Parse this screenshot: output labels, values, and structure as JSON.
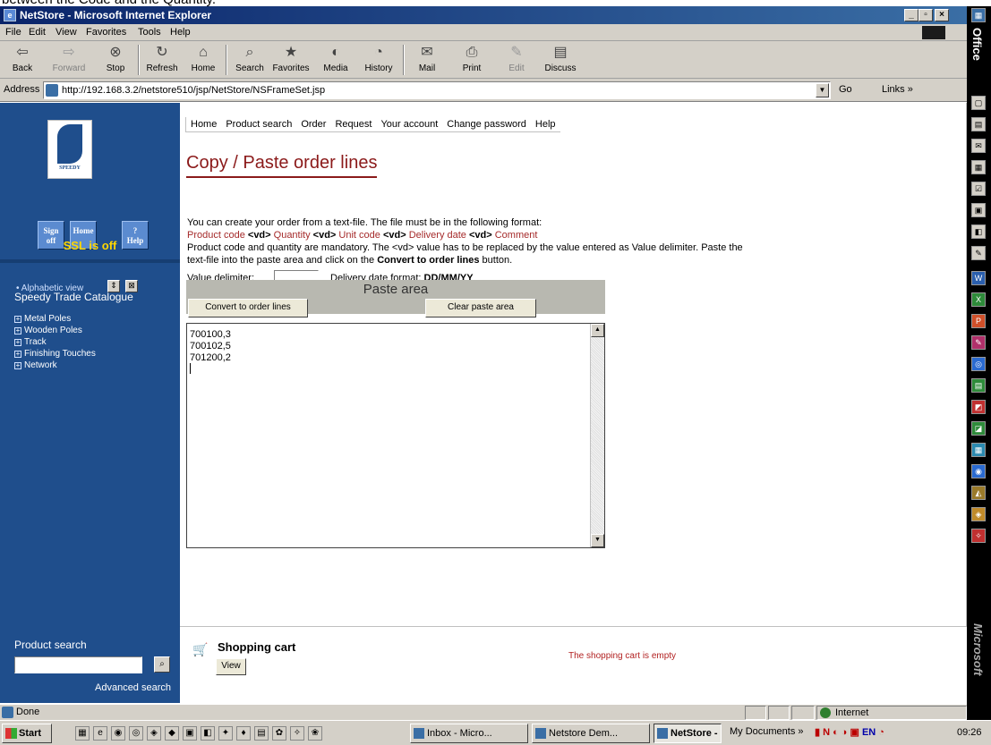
{
  "caption": "between the Code and the Quantity.",
  "window": {
    "title": "NetStore - Microsoft Internet Explorer",
    "minimize": "_",
    "maximize": "▫",
    "close": "×"
  },
  "menu": [
    "File",
    "Edit",
    "View",
    "Favorites",
    "Tools",
    "Help"
  ],
  "toolbar": {
    "back": "Back",
    "forward": "Forward",
    "stop": "Stop",
    "refresh": "Refresh",
    "home": "Home",
    "search": "Search",
    "favorites": "Favorites",
    "media": "Media",
    "history": "History",
    "mail": "Mail",
    "print": "Print",
    "edit": "Edit",
    "discuss": "Discuss"
  },
  "address": {
    "label": "Address",
    "url": "http://192.168.3.2/netstore510/jsp/NetStore/NSFrameSet.jsp",
    "go": "Go",
    "links": "Links »"
  },
  "sidebar": {
    "logo_text": "SPEEDY",
    "sign_off": "Sign off",
    "home": "Home",
    "help": "Help",
    "help_mark": "?",
    "ssl": "SSL is off",
    "alpha_view": "• Alphabetic view",
    "catalog_title": "Speedy Trade Catalogue",
    "categories": [
      "Metal Poles",
      "Wooden Poles",
      "Track",
      "Finishing Touches",
      "Network"
    ],
    "product_search_label": "Product search",
    "advanced_search": "Advanced search"
  },
  "topnav": [
    "Home",
    "Product search",
    "Order",
    "Request",
    "Your account",
    "Change password",
    "Help"
  ],
  "main": {
    "title": "Copy / Paste order lines",
    "intro": "You can create your order from a text-file. The file must be in the following format:",
    "format": {
      "product_code": "Product code",
      "quantity": "Quantity",
      "unit_code": "Unit code",
      "delivery_date": "Delivery date",
      "comment": "Comment",
      "vd": "<vd>"
    },
    "mandatory_line1": "Product code and quantity are mandatory. The <vd> value has to be replaced by the value entered as Value delimiter.  Paste the",
    "mandatory_line2a": "text-file into the paste area and click on the ",
    "mandatory_line2b": "Convert to order lines",
    "mandatory_line2c": " button.",
    "value_delimiter_label": "Value delimiter:",
    "value_delimiter_value": ",",
    "date_format_label": "Delivery date format: ",
    "date_format_value": "DD/MM/YY",
    "paste_area_title": "Paste area",
    "convert_button": "Convert to order lines",
    "clear_button": "Clear paste area",
    "paste_lines": [
      "700100,3",
      "700102,5",
      "701200,2"
    ]
  },
  "cart": {
    "title": "Shopping cart",
    "view": "View",
    "empty_message": "The shopping cart is empty"
  },
  "status": {
    "text": "Done",
    "zone": "Internet"
  },
  "taskbar": {
    "start": "Start",
    "tasks": [
      "Inbox - Micro...",
      "Netstore Dem...",
      "NetStore - ..."
    ],
    "my_documents": "My Documents »",
    "lang": "EN",
    "clock": "09:26"
  },
  "officebar": {
    "office": "Office",
    "microsoft": "Microsoft"
  }
}
